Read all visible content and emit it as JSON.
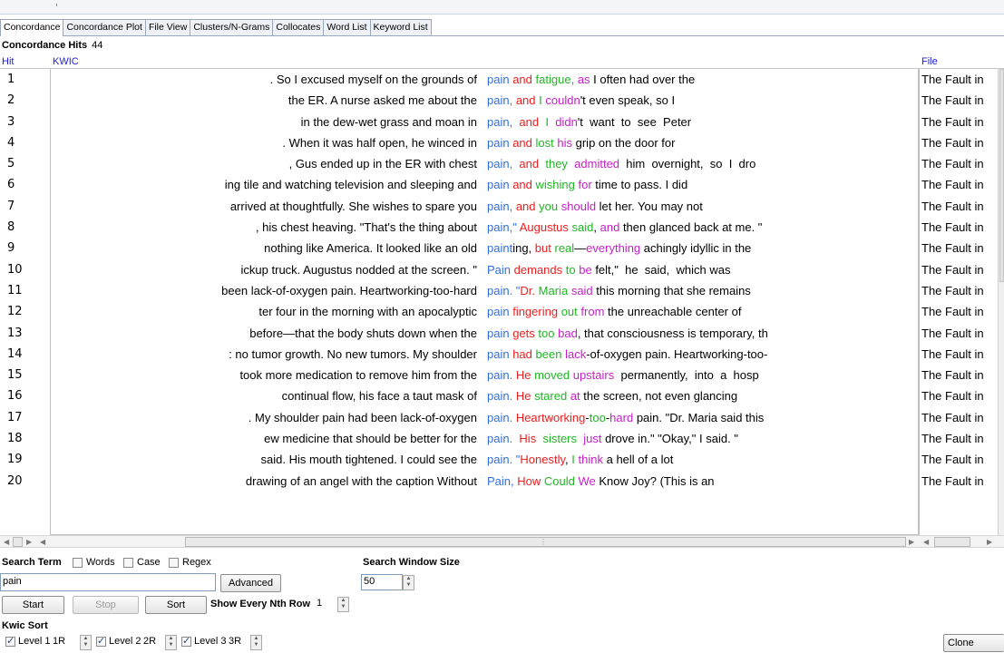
{
  "tabs": [
    "Concordance",
    "Concordance Plot",
    "File View",
    "Clusters/N-Grams",
    "Collocates",
    "Word List",
    "Keyword List"
  ],
  "hits": {
    "label": "Concordance Hits",
    "count": "44"
  },
  "columns": {
    "hit": "Hit",
    "kwic": "KWIC",
    "file": "File"
  },
  "rows": [
    {
      "n": "1",
      "left": ". So I excused myself on the grounds of",
      "kw": [
        [
          "pain",
          "b"
        ],
        [
          " ",
          ""
        ],
        [
          "and",
          "r"
        ],
        [
          " ",
          ""
        ],
        [
          "fatigue",
          "g"
        ],
        [
          ", ",
          "b"
        ],
        [
          "as",
          "m"
        ],
        [
          " I often had over the",
          ""
        ]
      ],
      "file": "The Fault in"
    },
    {
      "n": "2",
      "left": "the ER. A nurse asked me about the",
      "kw": [
        [
          "pain",
          "b"
        ],
        [
          ", ",
          "b"
        ],
        [
          "and",
          "r"
        ],
        [
          " ",
          ""
        ],
        [
          "I",
          "g"
        ],
        [
          " ",
          ""
        ],
        [
          "couldn",
          "m"
        ],
        [
          "'t even speak, so I",
          ""
        ]
      ],
      "file": "The Fault in"
    },
    {
      "n": "3",
      "left": "in the dew-wet grass and moan  in",
      "kw": [
        [
          "pain",
          "b"
        ],
        [
          ",  ",
          "b"
        ],
        [
          "and",
          "r"
        ],
        [
          "  ",
          ""
        ],
        [
          "I",
          "g"
        ],
        [
          "  ",
          ""
        ],
        [
          "didn",
          "m"
        ],
        [
          "'t  want  to  see  Peter",
          ""
        ]
      ],
      "file": "The Fault in"
    },
    {
      "n": "4",
      "left": ". When it was half open, he winced in",
      "kw": [
        [
          "pain",
          "b"
        ],
        [
          " ",
          ""
        ],
        [
          "and",
          "r"
        ],
        [
          " ",
          ""
        ],
        [
          "lost",
          "g"
        ],
        [
          " ",
          ""
        ],
        [
          "his",
          "m"
        ],
        [
          " grip on the door for",
          ""
        ]
      ],
      "file": "The Fault in"
    },
    {
      "n": "5",
      "left": ", Gus  ended  up  in  the  ER  with  chest",
      "kw": [
        [
          "pain",
          "b"
        ],
        [
          ",  ",
          "b"
        ],
        [
          "and",
          "r"
        ],
        [
          "  ",
          ""
        ],
        [
          "they",
          "g"
        ],
        [
          "  ",
          ""
        ],
        [
          "admitted",
          "m"
        ],
        [
          "  him  overnight,  so  I  dro",
          ""
        ]
      ],
      "file": "The Fault in"
    },
    {
      "n": "6",
      "left": "ing tile and watching television and sleeping and",
      "kw": [
        [
          "pain",
          "b"
        ],
        [
          " ",
          ""
        ],
        [
          "and",
          "r"
        ],
        [
          " ",
          ""
        ],
        [
          "wishing",
          "g"
        ],
        [
          " ",
          ""
        ],
        [
          "for",
          "m"
        ],
        [
          " time to pass. I did",
          ""
        ]
      ],
      "file": "The Fault in"
    },
    {
      "n": "7",
      "left": "arrived at thoughtfully. She wishes to spare you",
      "kw": [
        [
          "pain",
          "b"
        ],
        [
          ", ",
          "b"
        ],
        [
          "and",
          "r"
        ],
        [
          " ",
          ""
        ],
        [
          "you",
          "g"
        ],
        [
          " ",
          ""
        ],
        [
          "should",
          "m"
        ],
        [
          " let her. You may not",
          ""
        ]
      ],
      "file": "The Fault in"
    },
    {
      "n": "8",
      "left": ", his chest heaving. \"That's the thing about",
      "kw": [
        [
          "pain",
          "b"
        ],
        [
          ",\" ",
          "b"
        ],
        [
          "Augustus",
          "r"
        ],
        [
          " ",
          ""
        ],
        [
          "said",
          "g"
        ],
        [
          ", ",
          ""
        ],
        [
          "and",
          "m"
        ],
        [
          " then glanced back at me. \"",
          ""
        ]
      ],
      "file": "The Fault in"
    },
    {
      "n": "9",
      "left": "nothing like America. It looked like an old",
      "kw": [
        [
          "paint",
          "b"
        ],
        [
          "ing, ",
          ""
        ],
        [
          "but",
          "r"
        ],
        [
          " ",
          ""
        ],
        [
          "real",
          "g"
        ],
        [
          "—",
          ""
        ],
        [
          "everything",
          "m"
        ],
        [
          " achingly idyllic in the",
          ""
        ]
      ],
      "file": "The Fault in"
    },
    {
      "n": "10",
      "left": "ickup truck. Augustus  nodded  at  the  screen.  \"",
      "kw": [
        [
          "Pain",
          "b"
        ],
        [
          " ",
          ""
        ],
        [
          "demands",
          "r"
        ],
        [
          " ",
          ""
        ],
        [
          "to",
          "g"
        ],
        [
          " ",
          ""
        ],
        [
          "be",
          "m"
        ],
        [
          " felt,\"  he  said,  which was",
          ""
        ]
      ],
      "file": "The Fault in"
    },
    {
      "n": "11",
      "left": "been lack-of-oxygen pain. Heartworking-too-hard",
      "kw": [
        [
          "pain",
          "b"
        ],
        [
          ". \"",
          "b"
        ],
        [
          "Dr.",
          "r"
        ],
        [
          " ",
          ""
        ],
        [
          "Maria",
          "g"
        ],
        [
          " ",
          ""
        ],
        [
          "said",
          "m"
        ],
        [
          " this morning that she remains",
          ""
        ]
      ],
      "file": "The Fault in"
    },
    {
      "n": "12",
      "left": "ter four  in  the  morning  with  an  apocalyptic",
      "kw": [
        [
          "pain",
          "b"
        ],
        [
          " ",
          ""
        ],
        [
          "fingering",
          "r"
        ],
        [
          " ",
          ""
        ],
        [
          "out",
          "g"
        ],
        [
          " ",
          ""
        ],
        [
          "from",
          "m"
        ],
        [
          " the unreachable center of",
          ""
        ]
      ],
      "file": "The Fault in"
    },
    {
      "n": "13",
      "left": "before—that the body shuts down when the",
      "kw": [
        [
          "pain",
          "b"
        ],
        [
          " ",
          ""
        ],
        [
          "gets",
          "r"
        ],
        [
          " ",
          ""
        ],
        [
          "too",
          "g"
        ],
        [
          " ",
          ""
        ],
        [
          "bad",
          "m"
        ],
        [
          ", that consciousness is temporary, th",
          ""
        ]
      ],
      "file": "The Fault in"
    },
    {
      "n": "14",
      "left": ":  no  tumor growth. No new tumors. My shoulder",
      "kw": [
        [
          "pain",
          "b"
        ],
        [
          " ",
          ""
        ],
        [
          "had",
          "r"
        ],
        [
          " ",
          ""
        ],
        [
          "been",
          "g"
        ],
        [
          " ",
          ""
        ],
        [
          "lack",
          "m"
        ],
        [
          "-of-oxygen pain. Heartworking-too-",
          ""
        ]
      ],
      "file": "The Fault in"
    },
    {
      "n": "15",
      "left": "took more medication to remove him from the",
      "kw": [
        [
          "pain",
          "b"
        ],
        [
          ". ",
          "b"
        ],
        [
          "He",
          "r"
        ],
        [
          " ",
          ""
        ],
        [
          "moved",
          "g"
        ],
        [
          " ",
          ""
        ],
        [
          "upstairs",
          "m"
        ],
        [
          "  permanently,  into  a  hosp",
          ""
        ]
      ],
      "file": "The Fault in"
    },
    {
      "n": "16",
      "left": "continual flow, his face a taut mask of",
      "kw": [
        [
          "pain",
          "b"
        ],
        [
          ". ",
          "b"
        ],
        [
          "He",
          "r"
        ],
        [
          " ",
          ""
        ],
        [
          "stared",
          "g"
        ],
        [
          " ",
          ""
        ],
        [
          "at",
          "m"
        ],
        [
          " the screen, not even glancing",
          ""
        ]
      ],
      "file": "The Fault in"
    },
    {
      "n": "17",
      "left": ". My shoulder pain had been lack-of-oxygen",
      "kw": [
        [
          "pain",
          "b"
        ],
        [
          ". ",
          "b"
        ],
        [
          "Heartworking",
          "r"
        ],
        [
          "-",
          ""
        ],
        [
          "too",
          "g"
        ],
        [
          "-",
          ""
        ],
        [
          "hard",
          "m"
        ],
        [
          " pain. \"Dr. Maria said this",
          ""
        ]
      ],
      "file": "The Fault in"
    },
    {
      "n": "18",
      "left": "ew  medicine  that  should  be  better  for  the",
      "kw": [
        [
          "pain",
          "b"
        ],
        [
          ".  ",
          "b"
        ],
        [
          "His",
          "r"
        ],
        [
          "  ",
          ""
        ],
        [
          "sisters",
          "g"
        ],
        [
          "  ",
          ""
        ],
        [
          "just",
          "m"
        ],
        [
          " drove in.\" \"Okay,\" I said. \"",
          ""
        ]
      ],
      "file": "The Fault in"
    },
    {
      "n": "19",
      "left": "said. His mouth tightened. I could see the",
      "kw": [
        [
          "pain",
          "b"
        ],
        [
          ". \"",
          "b"
        ],
        [
          "Honestly",
          "r"
        ],
        [
          ", ",
          ""
        ],
        [
          "I",
          "g"
        ],
        [
          " ",
          ""
        ],
        [
          "think",
          "m"
        ],
        [
          " a hell of a lot",
          ""
        ]
      ],
      "file": "The Fault in"
    },
    {
      "n": "20",
      "left": "drawing  of  an  angel with the caption Without",
      "kw": [
        [
          "Pain",
          "b"
        ],
        [
          ", ",
          "b"
        ],
        [
          "How",
          "r"
        ],
        [
          " ",
          ""
        ],
        [
          "Could",
          "g"
        ],
        [
          " ",
          ""
        ],
        [
          "We",
          "m"
        ],
        [
          " Know Joy? (This is an",
          ""
        ]
      ],
      "file": "The Fault in"
    }
  ],
  "colors": {
    "b": "#2f6fe0",
    "r": "#ea1f1f",
    "g": "#22b526",
    "m": "#c51fc7"
  },
  "search": {
    "label": "Search Term",
    "words": "Words",
    "case": "Case",
    "regex": "Regex",
    "value": "pain",
    "advanced": "Advanced",
    "window_label": "Search Window Size",
    "window_value": "50"
  },
  "buttons": {
    "start": "Start",
    "stop": "Stop",
    "sort": "Sort",
    "clone": "Clone Result"
  },
  "nth": {
    "label": "Show Every Nth Row",
    "value": "1"
  },
  "kwic_sort": {
    "label": "Kwic Sort",
    "levels": [
      {
        "label": "Level 1",
        "value": "1R"
      },
      {
        "label": "Level 2",
        "value": "2R"
      },
      {
        "label": "Level 3",
        "value": "3R"
      }
    ]
  }
}
